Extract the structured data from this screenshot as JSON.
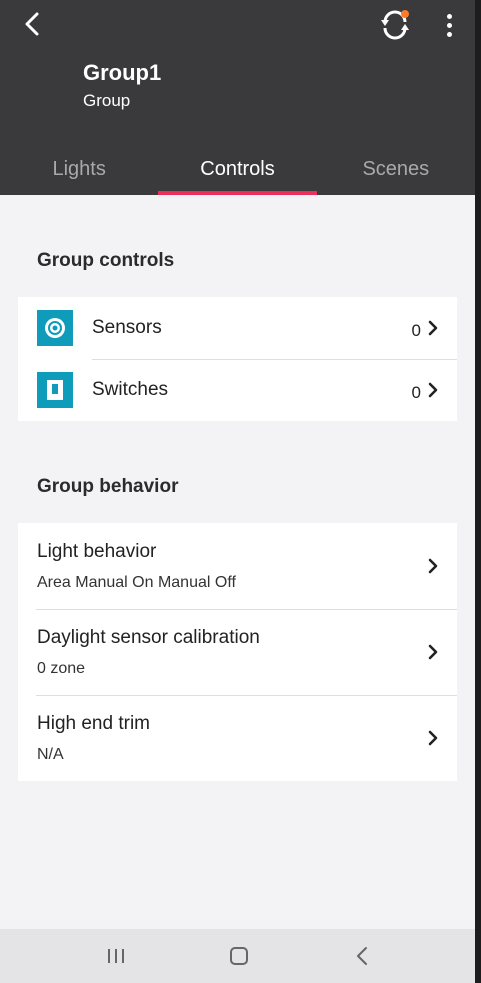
{
  "header": {
    "title": "Group1",
    "subtitle": "Group"
  },
  "tabs": [
    {
      "label": "Lights",
      "active": false
    },
    {
      "label": "Controls",
      "active": true
    },
    {
      "label": "Scenes",
      "active": false
    }
  ],
  "controls_section": {
    "title": "Group controls",
    "items": [
      {
        "label": "Sensors",
        "count": "0",
        "icon": "sensor-icon"
      },
      {
        "label": "Switches",
        "count": "0",
        "icon": "switch-icon"
      }
    ]
  },
  "behavior_section": {
    "title": "Group behavior",
    "items": [
      {
        "title": "Light behavior",
        "value": "Area Manual On Manual Off"
      },
      {
        "title": "Daylight sensor calibration",
        "value": "0 zone"
      },
      {
        "title": "High end trim",
        "value": "N/A"
      }
    ]
  },
  "colors": {
    "header_bg": "#3a3a3c",
    "accent": "#e8305a",
    "icon_bg": "#0f9cba",
    "notification_dot": "#ff7a2a"
  }
}
